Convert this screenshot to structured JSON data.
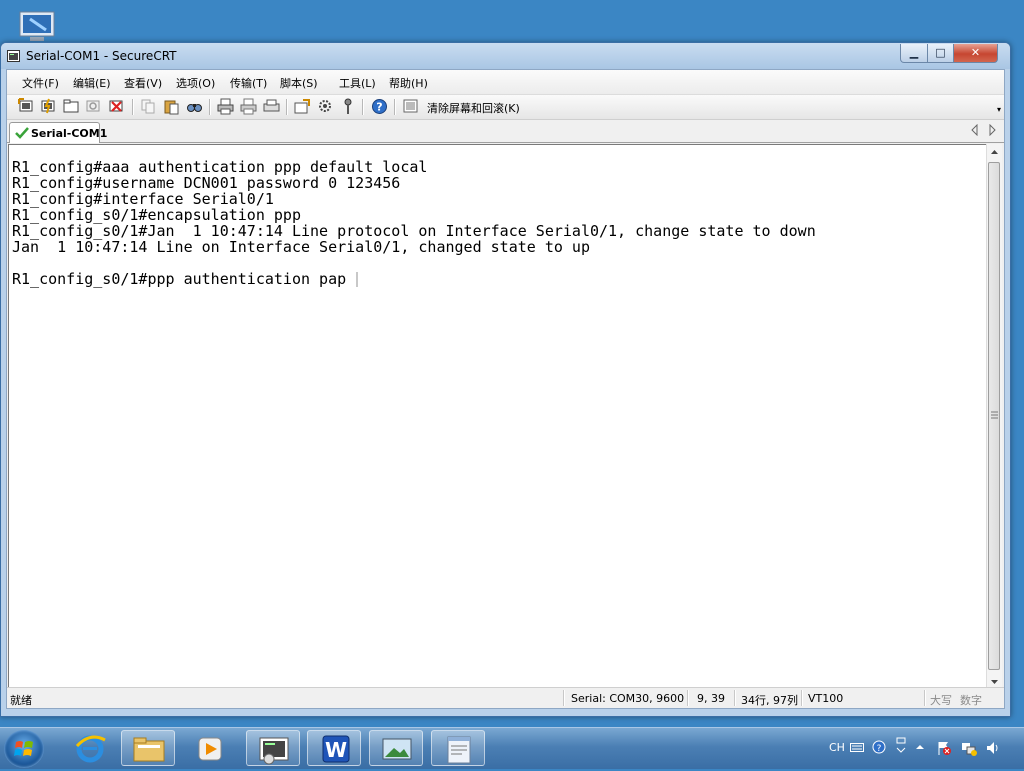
{
  "window": {
    "title": "Serial-COM1 - SecureCRT",
    "minimize_label": "▁",
    "maximize_label": "□",
    "close_label": "✕"
  },
  "menu": {
    "items": [
      "文件(F)",
      "编辑(E)",
      "查看(V)",
      "选项(O)",
      "传输(T)",
      "脚本(S)",
      "工具(L)",
      "帮助(H)"
    ]
  },
  "toolbar": {
    "clear_label": "清除屏幕和回滚(K)",
    "icons": [
      "connect-icon",
      "quick-connect-icon",
      "connect-tab-icon",
      "reconnect-icon",
      "disconnect-icon",
      "copy-icon",
      "paste-icon",
      "find-icon",
      "print-icon",
      "print-selection-icon",
      "print-setup-icon",
      "session-options-icon",
      "global-options-icon",
      "keymap-icon",
      "help-icon",
      "clear-screen-icon"
    ]
  },
  "tabs": [
    {
      "label": "Serial-COM1",
      "status_icon": "check-icon",
      "color": "#3aa33a"
    }
  ],
  "terminal": {
    "lines": [
      "R1_config#aaa authentication ppp default local",
      "R1_config#username DCN001 password 0 123456",
      "R1_config#interface Serial0/1",
      "R1_config_s0/1#encapsulation ppp",
      "R1_config_s0/1#Jan  1 10:47:14 Line protocol on Interface Serial0/1, change state to down",
      "Jan  1 10:47:14 Line on Interface Serial0/1, changed state to up",
      "",
      "R1_config_s0/1#ppp authentication pap "
    ]
  },
  "status": {
    "ready": "就绪",
    "serial": "Serial: COM30, 9600",
    "cursor": "9, 39",
    "size": "34行, 97列",
    "emulation": "VT100",
    "caps": "大写",
    "num": "数字"
  },
  "taskbar": {
    "apps": [
      "internet-explorer-icon",
      "file-explorer-icon",
      "media-player-icon",
      "securecrt-icon",
      "wps-writer-icon",
      "photo-viewer-icon",
      "notepad-icon"
    ],
    "tray": {
      "lang": "CH"
    }
  }
}
